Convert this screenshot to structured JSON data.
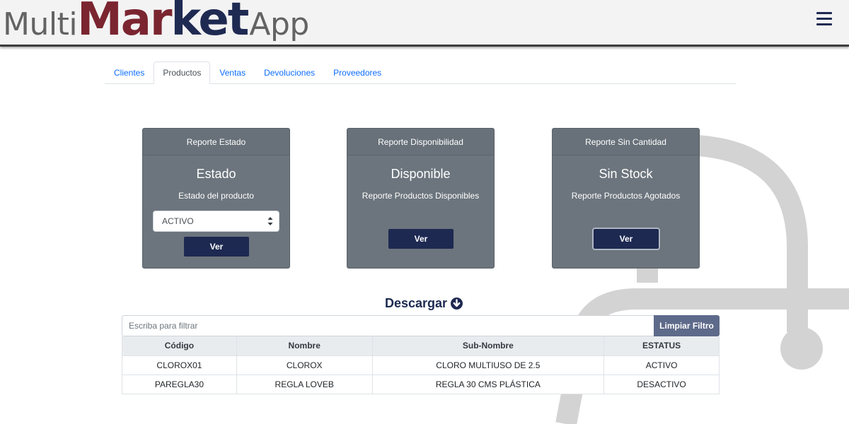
{
  "app": {
    "logo": {
      "part1": "Multi",
      "part2a": "Mar",
      "part2b": "ket",
      "part3": "App"
    },
    "menu_icon": "hamburger-menu-icon"
  },
  "tabs": [
    {
      "label": "Clientes",
      "active": false
    },
    {
      "label": "Productos",
      "active": true
    },
    {
      "label": "Ventas",
      "active": false
    },
    {
      "label": "Devoluciones",
      "active": false
    },
    {
      "label": "Proveedores",
      "active": false
    }
  ],
  "cards": [
    {
      "header": "Reporte Estado",
      "title": "Estado",
      "text": "Estado del producto",
      "select_value": "ACTIVO",
      "button": "Ver"
    },
    {
      "header": "Reporte Disponibilidad",
      "title": "Disponible",
      "text": "Reporte Productos Disponibles",
      "button": "Ver"
    },
    {
      "header": "Reporte Sin Cantidad",
      "title": "Sin Stock",
      "text": "Reporte Productos Agotados",
      "button": "Ver"
    }
  ],
  "download": {
    "label": "Descargar",
    "icon": "arrow-circle-down-icon"
  },
  "filter": {
    "placeholder": "Escriba para filtrar",
    "button": "Limpiar Filtro"
  },
  "table": {
    "columns": [
      "Código",
      "Nombre",
      "Sub-Nombre",
      "ESTATUS"
    ],
    "rows": [
      [
        "CLOROX01",
        "CLOROX",
        "CLORO MULTIUSO DE 2.5",
        "ACTIVO"
      ],
      [
        "PAREGLA30",
        "REGLA LOVEB",
        "REGLA 30 CMS PLÁSTICA",
        "DESACTIVO"
      ]
    ]
  },
  "colors": {
    "brand_dark": "#1d2951",
    "brand_red": "#7a2530",
    "card_bg": "#6c757d",
    "link": "#0d6efd"
  }
}
